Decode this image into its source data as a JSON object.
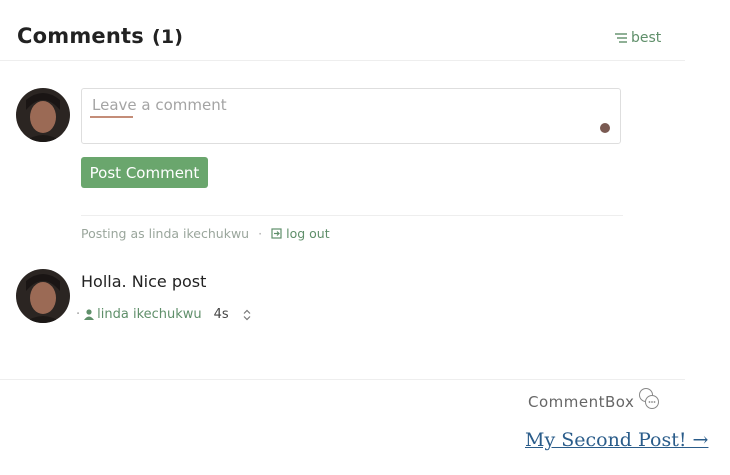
{
  "header": {
    "title": "Comments",
    "count": "(1)",
    "sort_label": "best",
    "sort_icon": "sort-lines-icon"
  },
  "composer": {
    "placeholder": "Leave a comment",
    "post_button": "Post Comment"
  },
  "session": {
    "posting_as": "Posting as linda ikechukwu",
    "separator": "·",
    "logout": "log out"
  },
  "comments": [
    {
      "text": "Holla. Nice post",
      "author": "linda ikechukwu",
      "time": "4s",
      "bullet": "·"
    }
  ],
  "footer": {
    "brand": "CommentBox",
    "next_post": "My Second Post! →"
  },
  "colors": {
    "accent": "#6aa66d",
    "link_green": "#5f8f6a",
    "link_blue": "#2a5c8a"
  }
}
